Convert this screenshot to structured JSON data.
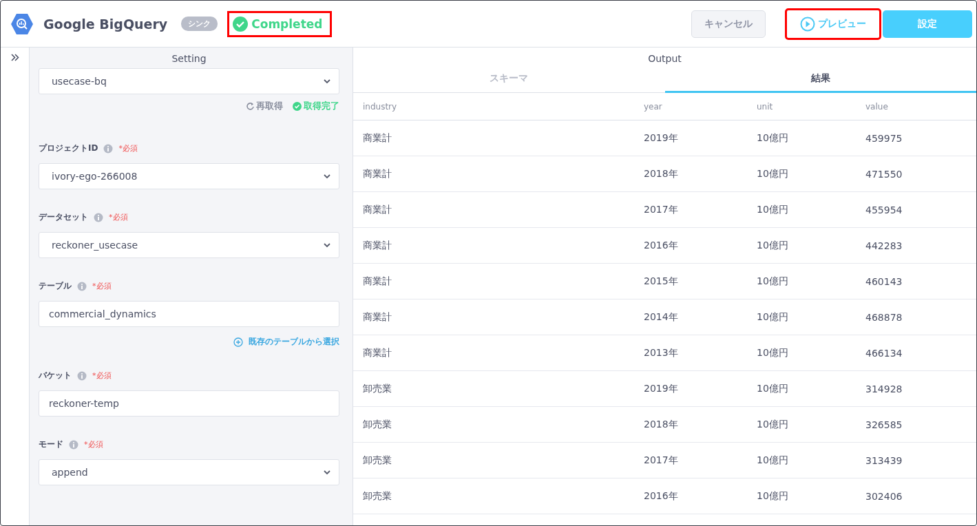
{
  "header": {
    "title": "Google BigQuery",
    "badge": "シンク",
    "status": {
      "label": "Completed",
      "highlighted": true
    },
    "buttons": [
      {
        "label": "キャンセル",
        "kind": "secondary",
        "highlighted": false
      },
      {
        "label": "プレビュー",
        "kind": "preview",
        "highlighted": true
      },
      {
        "label": "設定",
        "kind": "primary",
        "highlighted": false
      }
    ]
  },
  "setting": {
    "title": "Setting",
    "connection": {
      "value": "usecase-bq",
      "kind": "select"
    },
    "reload": "再取得",
    "fetch_status": "取得完了",
    "fields": [
      {
        "label": "プロジェクトID",
        "required": "*必須",
        "kind": "select",
        "value": "ivory-ego-266008"
      },
      {
        "label": "データセット",
        "required": "*必須",
        "kind": "select",
        "value": "reckoner_usecase"
      },
      {
        "label": "テーブル",
        "required": "*必須",
        "kind": "input",
        "value": "commercial_dynamics",
        "link": "既存のテーブルから選択"
      },
      {
        "label": "バケット",
        "required": "*必須",
        "kind": "input",
        "value": "reckoner-temp"
      },
      {
        "label": "モード",
        "required": "*必須",
        "kind": "select",
        "value": "append"
      }
    ]
  },
  "output": {
    "title": "Output",
    "tabs": [
      {
        "label": "スキーマ",
        "selected": false
      },
      {
        "label": "結果",
        "selected": true
      }
    ],
    "table": {
      "columns": [
        "industry",
        "year",
        "unit",
        "value"
      ],
      "rows": [
        [
          "商業計",
          "2019年",
          "10億円",
          "459975"
        ],
        [
          "商業計",
          "2018年",
          "10億円",
          "471550"
        ],
        [
          "商業計",
          "2017年",
          "10億円",
          "455954"
        ],
        [
          "商業計",
          "2016年",
          "10億円",
          "442283"
        ],
        [
          "商業計",
          "2015年",
          "10億円",
          "460143"
        ],
        [
          "商業計",
          "2014年",
          "10億円",
          "468878"
        ],
        [
          "商業計",
          "2013年",
          "10億円",
          "466134"
        ],
        [
          "卸売業",
          "2019年",
          "10億円",
          "314928"
        ],
        [
          "卸売業",
          "2018年",
          "10億円",
          "326585"
        ],
        [
          "卸売業",
          "2017年",
          "10億円",
          "313439"
        ],
        [
          "卸売業",
          "2016年",
          "10億円",
          "302406"
        ]
      ]
    }
  }
}
